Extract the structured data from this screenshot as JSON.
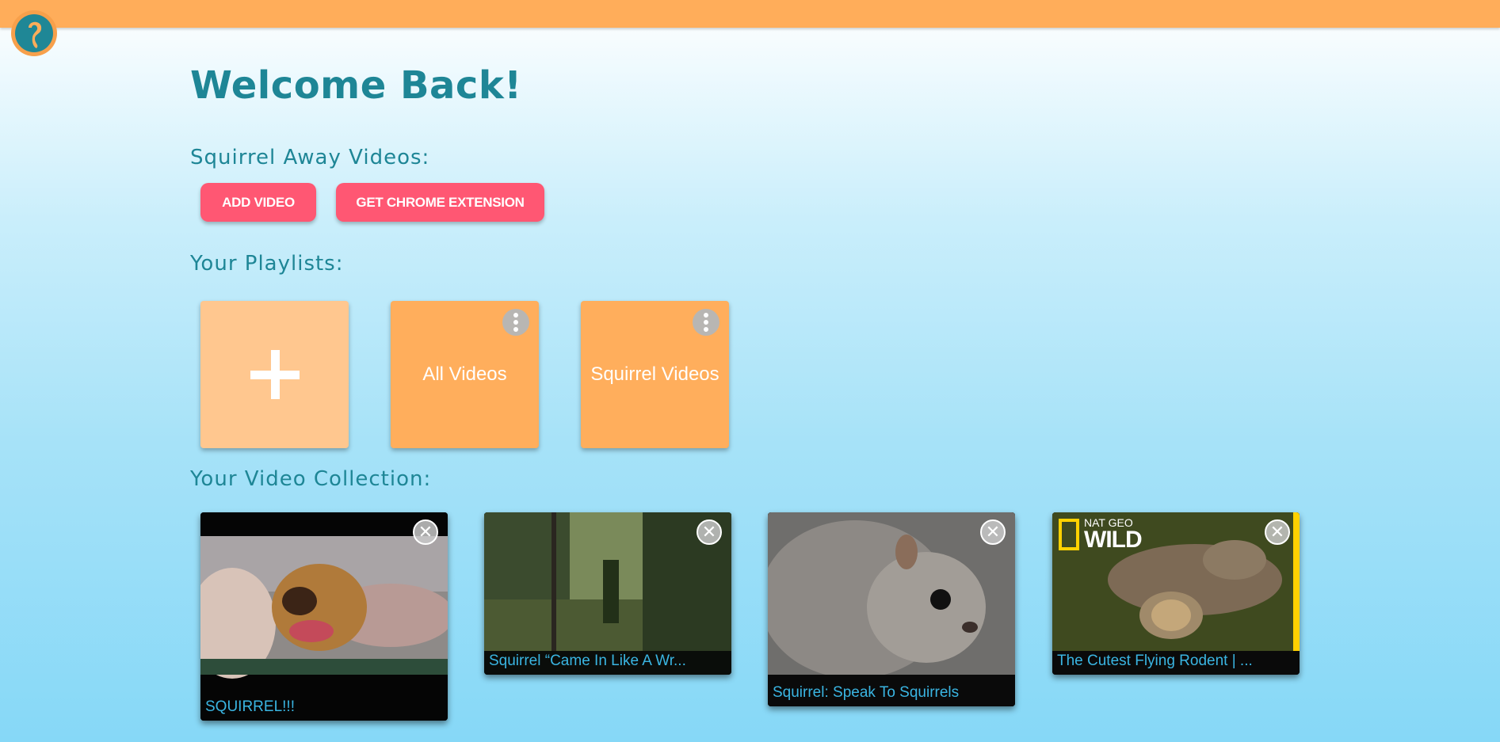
{
  "header": {
    "logo_icon": "squirrel-tail-logo",
    "bar_color": "#ffad5a"
  },
  "main": {
    "title": "Welcome Back!",
    "squirrel_away_heading": "Squirrel Away Videos:",
    "add_video_label": "ADD VIDEO",
    "chrome_extension_label": "GET CHROME EXTENSION",
    "playlists_heading": "Your Playlists:",
    "video_collection_heading": "Your Video Collection:"
  },
  "playlists": [
    {
      "label": "All Videos"
    },
    {
      "label": "Squirrel Videos"
    }
  ],
  "videos": [
    {
      "title": "SQUIRREL!!!"
    },
    {
      "title": "Squirrel “Came In Like A Wr..."
    },
    {
      "title": "Squirrel: Speak To Squirrels"
    },
    {
      "title": "The Cutest Flying Rodent | ...",
      "brand_line1": "NAT GEO",
      "brand_line2": "WILD"
    }
  ],
  "colors": {
    "accent": "#1e8696",
    "button": "#ff5773",
    "tile": "#ffae5c",
    "caption": "#3ab5e2"
  }
}
